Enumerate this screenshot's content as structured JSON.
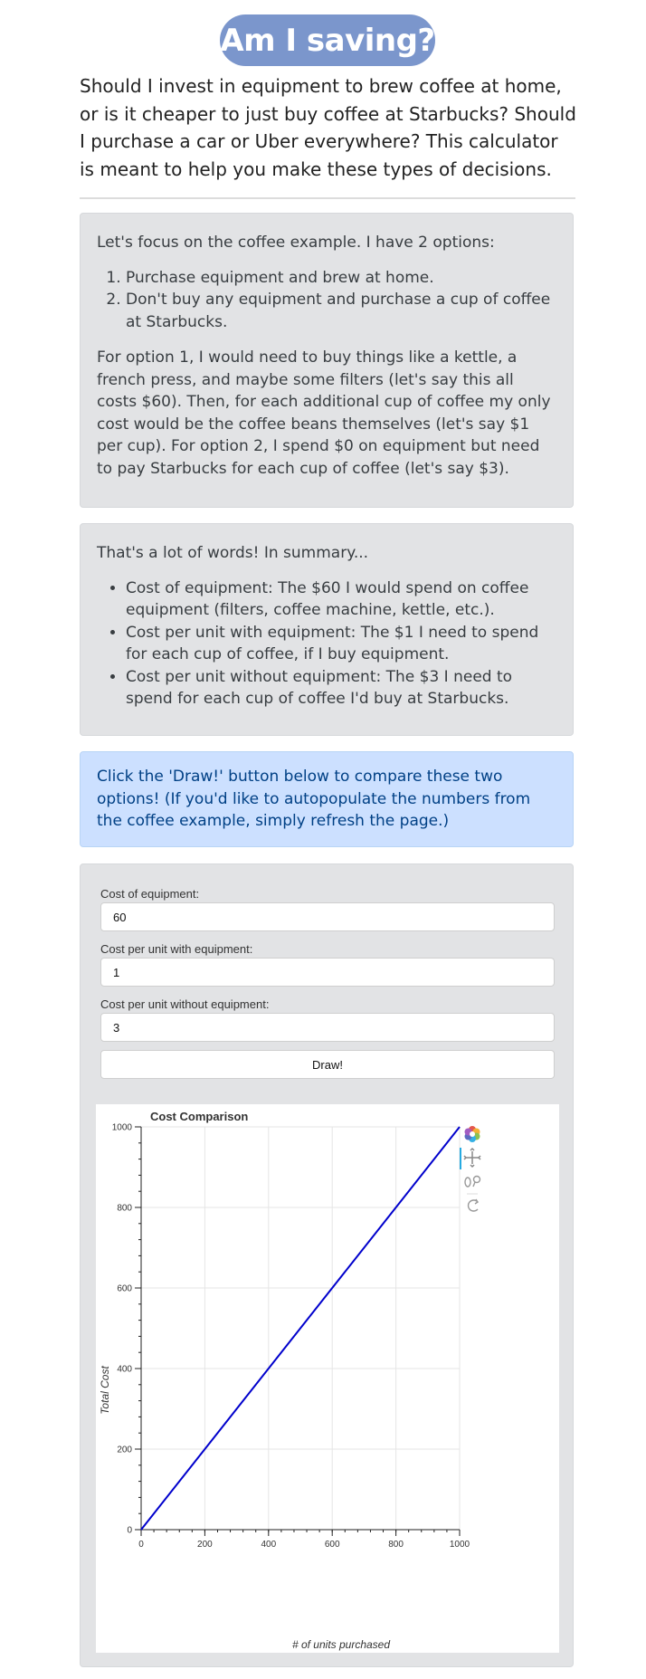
{
  "header": {
    "title": "Am I saving?"
  },
  "intro": "Should I invest in equipment to brew coffee at home, or is it cheaper to just buy coffee at Starbucks? Should I purchase a car or Uber everywhere? This calculator is meant to help you make these types of decisions.",
  "example": {
    "lead": "Let's focus on the coffee example. I have 2 options:",
    "options": [
      "Purchase equipment and brew at home.",
      "Don't buy any equipment and purchase a cup of coffee at Starbucks."
    ],
    "body": "For option 1, I would need to buy things like a kettle, a french press, and maybe some filters (let's say this all costs $60). Then, for each additional cup of coffee my only cost would be the coffee beans themselves (let's say $1 per cup). For option 2, I spend $0 on equipment but need to pay Starbucks for each cup of coffee (let's say $3)."
  },
  "summary": {
    "lead": "That's a lot of words! In summary...",
    "items": [
      "Cost of equipment: The $60 I would spend on coffee equipment (filters, coffee machine, kettle, etc.).",
      "Cost per unit with equipment: The $1 I need to spend for each cup of coffee, if I buy equipment.",
      "Cost per unit without equipment: The $3 I need to spend for each cup of coffee I'd buy at Starbucks."
    ]
  },
  "info": "Click the 'Draw!' button below to compare these two options! (If you'd like to autopopulate the numbers from the coffee example, simply refresh the page.)",
  "form": {
    "equipment_label": "Cost of equipment:",
    "equipment_value": "60",
    "with_label": "Cost per unit with equipment:",
    "with_value": "1",
    "without_label": "Cost per unit without equipment:",
    "without_value": "3",
    "draw_label": "Draw!"
  },
  "toolbar": {
    "icons": [
      "bokeh-logo-icon",
      "pan-icon",
      "wheel-zoom-icon",
      "reset-icon"
    ]
  },
  "colors": {
    "accent": "#7b96cc",
    "line": "#0000cc",
    "info_bg": "#cce0ff",
    "card_bg": "#e2e3e5"
  },
  "chart_data": {
    "type": "line",
    "title": "Cost Comparison",
    "xlabel": "# of units purchased",
    "ylabel": "Total Cost",
    "xlim": [
      0,
      1000
    ],
    "ylim": [
      0,
      1000
    ],
    "x_ticks": [
      "0",
      "200",
      "400",
      "600",
      "800",
      "1000"
    ],
    "y_ticks": [
      "0",
      "200",
      "400",
      "600",
      "800",
      "1000"
    ],
    "grid": true,
    "series": [
      {
        "x": [
          0,
          1000
        ],
        "y": [
          0,
          1000
        ],
        "color": "#0000cc"
      }
    ]
  }
}
